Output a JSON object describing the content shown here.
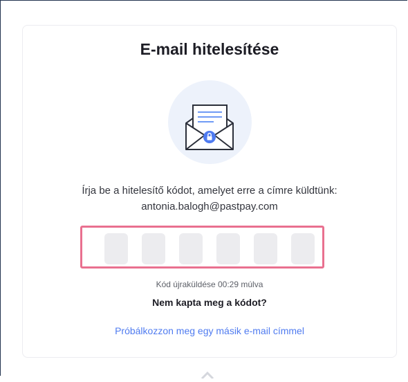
{
  "card": {
    "title": "E-mail hitelesítése",
    "illustration_icon": "envelope-lock-icon",
    "instruction": "Írja be a hitelesítő kódot, amelyet erre a címre küldtünk:",
    "email": "antonia.balogh@pastpay.com",
    "code_inputs": [
      "",
      "",
      "",
      "",
      "",
      ""
    ],
    "resend_text": "Kód újraküldése 00:29 múlva",
    "not_received": "Nem kapta meg a kódot?",
    "alt_email_link": "Próbálkozzon meg egy másik e-mail címmel"
  },
  "colors": {
    "accent_link": "#4f7bf0",
    "highlight_border": "#e9708f",
    "illustration_bg": "#edf2fb"
  }
}
